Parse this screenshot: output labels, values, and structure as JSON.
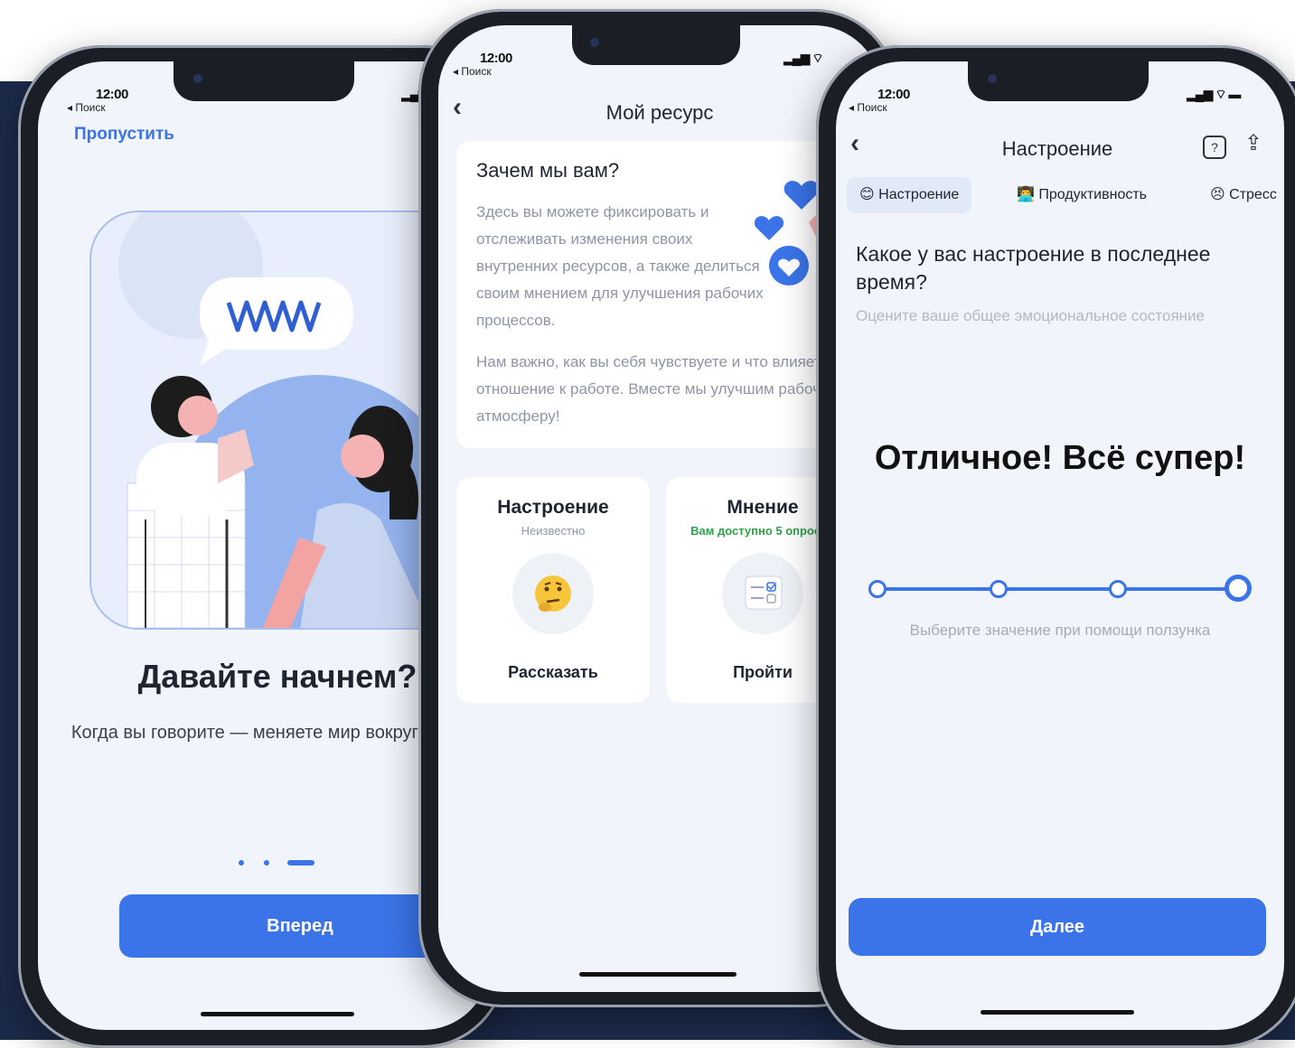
{
  "phone1": {
    "time": "12:00",
    "back_link": "◂ Поиск",
    "skip_label": "Пропустить",
    "title": "Давайте начнем?",
    "subtitle": "Когда вы говорите — меняете мир вокруг себя",
    "pager": {
      "total": 3,
      "active": 3
    },
    "next_button": "Вперед"
  },
  "phone2": {
    "time": "12:00",
    "back_link": "◂ Поиск",
    "nav_title": "Мой ресурс",
    "info_card": {
      "title": "Зачем мы вам?",
      "paragraph1": "Здесь вы можете фиксировать и отслеживать изменения своих внутренних ресурсов, а также делиться своим мнением для улучшения рабочих процессов.",
      "paragraph2": "Нам важно, как вы себя чувствуете и что влияет на отношение к работе. Вместе мы улучшим рабочую атмосферу!"
    },
    "tiles": [
      {
        "title": "Настроение",
        "subtitle": "Неизвестно",
        "icon": "thinking-face-emoji",
        "action": "Рассказать"
      },
      {
        "title": "Мнение",
        "subtitle": "Вам доступно 5 опросов",
        "icon": "checklist-icon",
        "action": "Пройти"
      }
    ]
  },
  "phone3": {
    "time": "12:00",
    "back_link": "◂ Поиск",
    "nav_title": "Настроение",
    "tabs": [
      {
        "emoji": "😊",
        "label": "Настроение",
        "active": true
      },
      {
        "emoji": "👨‍💻",
        "label": "Продуктивность",
        "active": false
      },
      {
        "emoji": "😣",
        "label": "Стресс",
        "active": false
      }
    ],
    "question": "Какое у вас настроение в последнее время?",
    "question_hint": "Оцените ваше общее эмоциональное состояние",
    "mood_value": "Отличное! Всё супер!",
    "slider": {
      "steps": 4,
      "selected": 4
    },
    "slider_hint": "Выберите значение при помощи ползунка",
    "continue_button": "Далее"
  },
  "colors": {
    "accent": "#3a74e8",
    "screen_bg": "#f1f4fa",
    "backdrop": "#1c2a4a",
    "success": "#2fa24a"
  }
}
